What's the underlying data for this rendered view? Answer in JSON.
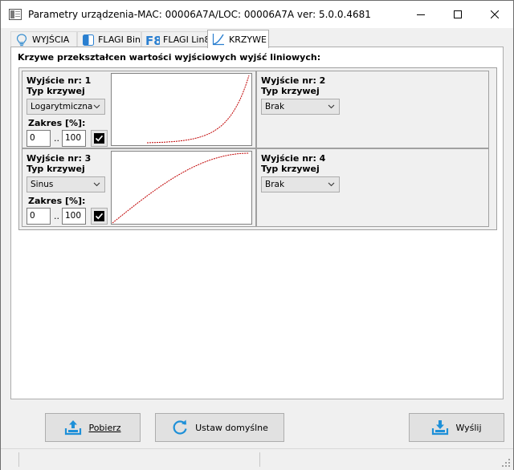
{
  "window": {
    "title": "Parametry urządzenia-MAC: 00006A7A/LOC: 00006A7A ver: 5.0.0.4681",
    "controls": [
      "minimize",
      "maximize",
      "close"
    ]
  },
  "tabs": [
    {
      "label": "WYJŚCIA",
      "icon": "lightbulb-icon",
      "active": false
    },
    {
      "label": "FLAGI Bin",
      "icon": "half-square-icon",
      "active": false
    },
    {
      "label": "FLAGI Lin8",
      "icon": "f8-icon",
      "active": false
    },
    {
      "label": "KRZYWE",
      "icon": "curve-icon",
      "active": true
    }
  ],
  "heading": "Krzywe przekształcen wartości wyjściowych wyjść liniowych:",
  "outputs": [
    {
      "title": "Wyjście nr: 1",
      "type_label": "Typ krzywej",
      "type_value": "Logarytmiczna",
      "range_label": "Zakres [%]:",
      "from": "0",
      "sep": "..",
      "to": "100",
      "checked": true,
      "curve": "exponential"
    },
    {
      "title": "Wyjście nr: 2",
      "type_label": "Typ krzywej",
      "type_value": "Brak"
    },
    {
      "title": "Wyjście nr: 3",
      "type_label": "Typ krzywej",
      "type_value": "Sinus",
      "range_label": "Zakres [%]:",
      "from": "0",
      "sep": "..",
      "to": "100",
      "checked": true,
      "curve": "sine"
    },
    {
      "title": "Wyjście nr: 4",
      "type_label": "Typ krzywej",
      "type_value": "Brak"
    }
  ],
  "buttons": {
    "fetch": "Pobierz",
    "defaults": "Ustaw domyślne",
    "send": "Wyślij"
  },
  "colors": {
    "curve": "#c00000",
    "button_icon": "#1e90d8"
  }
}
